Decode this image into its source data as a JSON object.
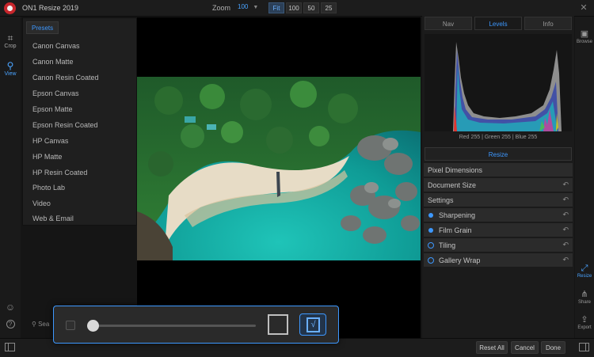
{
  "window": {
    "title": "ON1 Resize 2019"
  },
  "zoom": {
    "label": "Zoom",
    "value": "100",
    "options": [
      "Fit",
      "100",
      "50",
      "25"
    ],
    "active_option": "Fit"
  },
  "left_tools": {
    "crop": "Crop",
    "view": "View"
  },
  "presets": {
    "header": "Presets",
    "items": [
      "Canon Canvas",
      "Canon Matte",
      "Canon Resin Coated",
      "Epson Canvas",
      "Epson Matte",
      "Epson Resin Coated",
      "HP Canvas",
      "HP Matte",
      "HP Resin Coated",
      "Photo Lab",
      "Video",
      "Web & Email"
    ]
  },
  "search": {
    "placeholder": "Sea"
  },
  "right_tabs": [
    "Nav",
    "Levels",
    "Info"
  ],
  "active_tab": "Levels",
  "histogram": {
    "readout": "Red 255 | Green 255 | Blue 255"
  },
  "resize_button": "Resize",
  "sections": [
    {
      "label": "Pixel Dimensions",
      "marker": "none",
      "reset": false
    },
    {
      "label": "Document Size",
      "marker": "none",
      "reset": true
    },
    {
      "label": "Settings",
      "marker": "none",
      "reset": true
    },
    {
      "label": "Sharpening",
      "marker": "dot",
      "reset": true
    },
    {
      "label": "Film Grain",
      "marker": "dot",
      "reset": true
    },
    {
      "label": "Tiling",
      "marker": "ring",
      "reset": true
    },
    {
      "label": "Gallery Wrap",
      "marker": "ring",
      "reset": true
    }
  ],
  "far_right": {
    "browse": "Browse",
    "resize": "Resize",
    "share": "Share",
    "export": "Export"
  },
  "bottom": {
    "reset_all": "Reset All",
    "cancel": "Cancel",
    "done": "Done"
  },
  "overlay_slider": {
    "value_fraction": 0.0
  },
  "colors": {
    "accent": "#3d98ff",
    "logo": "#c8262c"
  }
}
